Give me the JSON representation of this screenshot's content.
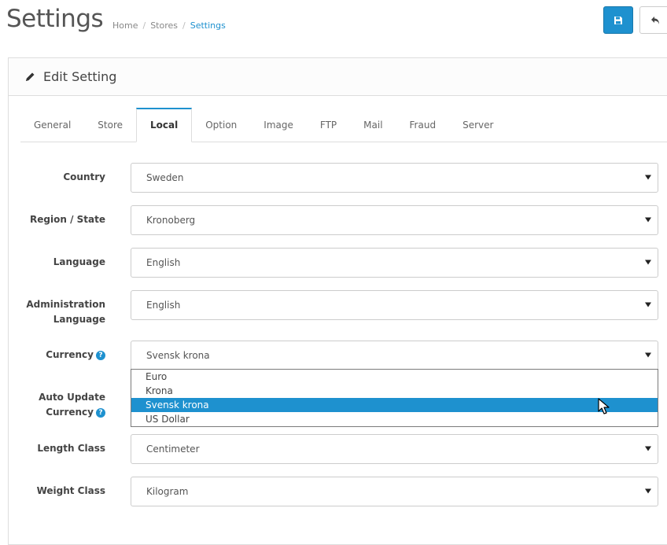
{
  "header": {
    "title": "Settings",
    "breadcrumb": [
      "Home",
      "Stores",
      "Settings"
    ],
    "save_icon": "save-icon",
    "back_icon": "reply-icon"
  },
  "panel": {
    "title": "Edit Setting",
    "icon": "pencil-icon"
  },
  "tabs": [
    "General",
    "Store",
    "Local",
    "Option",
    "Image",
    "FTP",
    "Mail",
    "Fraud",
    "Server"
  ],
  "active_tab": "Local",
  "fields": {
    "country": {
      "label": "Country",
      "value": "Sweden"
    },
    "region": {
      "label": "Region / State",
      "value": "Kronoberg"
    },
    "language": {
      "label": "Language",
      "value": "English"
    },
    "admin_language": {
      "label_line1": "Administration",
      "label_line2": "Language",
      "value": "English"
    },
    "currency": {
      "label": "Currency",
      "value": "Svensk krona",
      "options": [
        "Euro",
        "Krona",
        "Svensk krona",
        "US Dollar"
      ],
      "highlighted": "Svensk krona"
    },
    "auto_update": {
      "label_line1": "Auto Update",
      "label_line2": "Currency"
    },
    "length_class": {
      "label": "Length Class",
      "value": "Centimeter"
    },
    "weight_class": {
      "label": "Weight Class",
      "value": "Kilogram"
    }
  },
  "help_glyph": "?",
  "colors": {
    "primary": "#1e91cf",
    "border": "#dddddd"
  }
}
